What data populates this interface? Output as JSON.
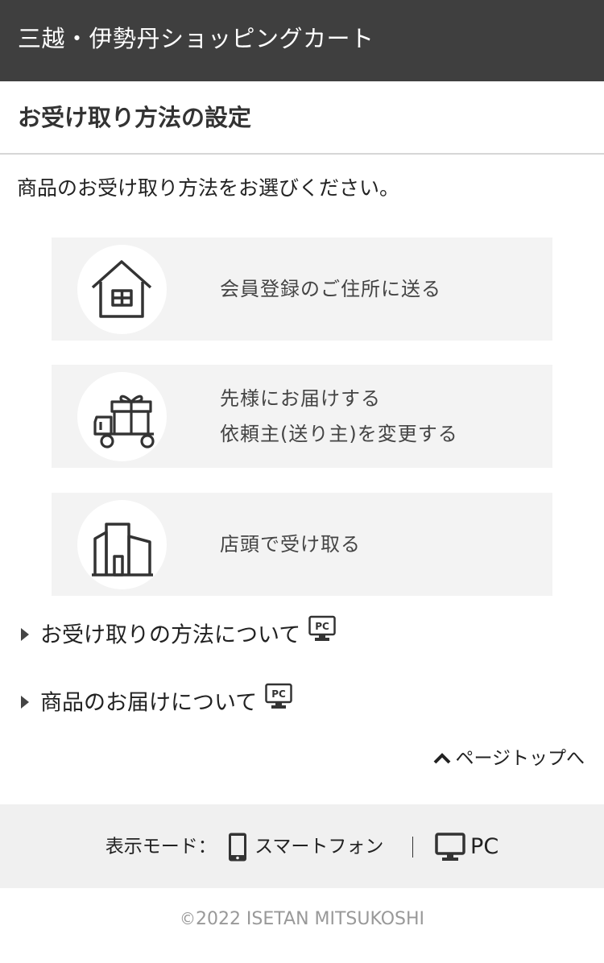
{
  "header": {
    "title": "三越・伊勢丹ショッピングカート"
  },
  "page": {
    "title": "お受け取り方法の設定",
    "intro": "商品のお受け取り方法をお選びください。"
  },
  "options": [
    {
      "icon": "house-icon",
      "label_line1": "会員登録のご住所に送る"
    },
    {
      "icon": "gift-cart-icon",
      "label_line1": "先様にお届けする",
      "label_line2": "依頼主(送り主)を変更する"
    },
    {
      "icon": "store-building-icon",
      "label_line1": "店頭で受け取る"
    }
  ],
  "links": [
    {
      "label": "お受け取りの方法について",
      "badge": "PC"
    },
    {
      "label": "商品のお届けについて",
      "badge": "PC"
    }
  ],
  "pagetop": {
    "label": "ページトップへ"
  },
  "footer": {
    "mode_label": "表示モード：",
    "smartphone_label": "スマートフォン",
    "pc_label": "PC",
    "copyright": "2022 ISETAN MITSUKOSHI"
  },
  "colors": {
    "header_bg": "#3f3f3f",
    "option_bg": "#f3f3f3",
    "footer_bg": "#f0f0f0"
  }
}
